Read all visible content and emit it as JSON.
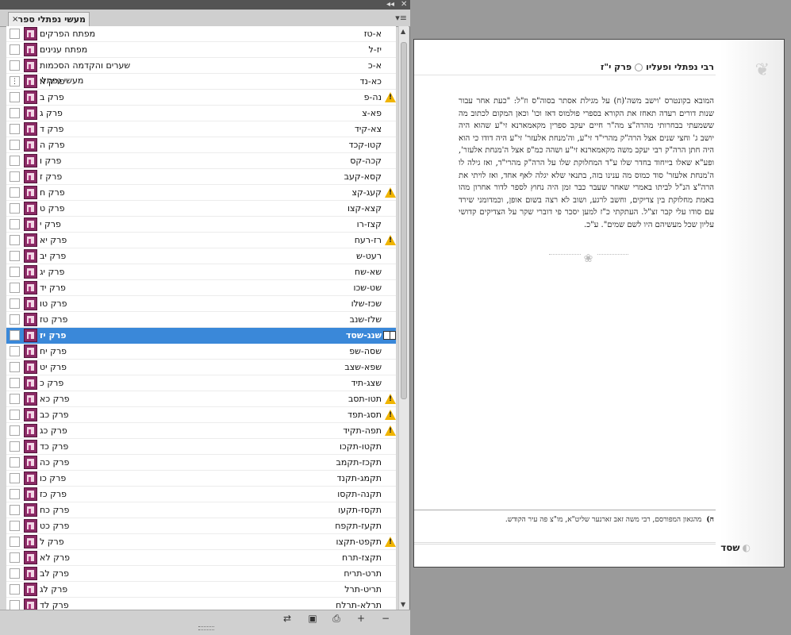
{
  "panel": {
    "collapse_glyph": "◂◂",
    "close_glyph": "✕",
    "tab_title": "מעשי נפתלי ספר",
    "tab_close": "×",
    "menu_glyph": "▾≡",
    "rows": [
      {
        "name": "מפתח הפרקים",
        "pages": "א-טז",
        "status": "none"
      },
      {
        "name": "מפתח ענינים",
        "pages": "יז-ל",
        "status": "none"
      },
      {
        "name": "שערים והקדמה הסכמות מעשי נפתלי",
        "pages": "א-כ",
        "status": "none"
      },
      {
        "name": "פרק א",
        "pages": "כא-נד",
        "status": "none"
      },
      {
        "name": "פרק ב",
        "pages": "נה-פ",
        "status": "warning"
      },
      {
        "name": "פרק ג",
        "pages": "פא-צ",
        "status": "none"
      },
      {
        "name": "פרק ד",
        "pages": "צא-קיד",
        "status": "none"
      },
      {
        "name": "פרק ה",
        "pages": "קטו-קכד",
        "status": "none"
      },
      {
        "name": "פרק ו",
        "pages": "קכה-קס",
        "status": "none"
      },
      {
        "name": "פרק ז",
        "pages": "קסא-קעב",
        "status": "none"
      },
      {
        "name": "פרק ח",
        "pages": "קעג-קצ",
        "status": "warning"
      },
      {
        "name": "פרק ט",
        "pages": "קצא-קצו",
        "status": "none"
      },
      {
        "name": "פרק י",
        "pages": "קצז-רו",
        "status": "none"
      },
      {
        "name": "פרק יא",
        "pages": "רז-רעח",
        "status": "warning"
      },
      {
        "name": "פרק יב",
        "pages": "רעט-ש",
        "status": "none"
      },
      {
        "name": "פרק יג",
        "pages": "שא-שח",
        "status": "none"
      },
      {
        "name": "פרק יד",
        "pages": "שט-שכו",
        "status": "none"
      },
      {
        "name": "פרק טו",
        "pages": "שכז-שלו",
        "status": "none"
      },
      {
        "name": "פרק טז",
        "pages": "שלז-שנב",
        "status": "none"
      },
      {
        "name": "פרק יז",
        "pages": "שנג-שסד",
        "status": "open",
        "selected": true
      },
      {
        "name": "פרק יח",
        "pages": "שסה-שפ",
        "status": "none"
      },
      {
        "name": "פרק יט",
        "pages": "שפא-שצב",
        "status": "none"
      },
      {
        "name": "פרק כ",
        "pages": "שצג-תיד",
        "status": "none"
      },
      {
        "name": "פרק כא",
        "pages": "תטו-תסב",
        "status": "warning"
      },
      {
        "name": "פרק כב",
        "pages": "תסג-תפד",
        "status": "warning"
      },
      {
        "name": "פרק כג",
        "pages": "תפה-תקיד",
        "status": "warning"
      },
      {
        "name": "פרק כד",
        "pages": "תקטו-תקכו",
        "status": "none"
      },
      {
        "name": "פרק כה",
        "pages": "תקכז-תקמב",
        "status": "none"
      },
      {
        "name": "פרק כו",
        "pages": "תקמג-תקנד",
        "status": "none"
      },
      {
        "name": "פרק כז",
        "pages": "תקנה-תקסו",
        "status": "none"
      },
      {
        "name": "פרק כח",
        "pages": "תקסז-תקעו",
        "status": "none"
      },
      {
        "name": "פרק כט",
        "pages": "תקעז-תקפח",
        "status": "none"
      },
      {
        "name": "פרק ל",
        "pages": "תקפט-תקצו",
        "status": "warning"
      },
      {
        "name": "פרק לא",
        "pages": "תקצז-תרח",
        "status": "none"
      },
      {
        "name": "פרק לב",
        "pages": "תרט-תריח",
        "status": "none"
      },
      {
        "name": "פרק לג",
        "pages": "תריט-תרל",
        "status": "none"
      },
      {
        "name": "פרק לד",
        "pages": "תרלא-תרלח",
        "status": "none"
      }
    ],
    "row4_marker": "⋮",
    "bottom_icons": [
      "synchronize-icon",
      "save-icon",
      "print-icon",
      "add-document-icon",
      "remove-document-icon"
    ]
  },
  "page": {
    "header": "פרק י\"ז",
    "header_title": "רבי נפתלי ופעליו",
    "paragraph": "המובא בקונטרס 'וישב משה'(ח) על מגילת אסתר בסוה\"ס וז\"ל: \"כעת אחר עבור שנות דורים רעדה תאחז את הקורא בספרי פולמוס דאז וכו' וכאן המקום לכתוב מה ששמעתי בבחרותי מהרה\"צ מה\"ר חיים יעקב ספרין מקאמארנא זי\"ע שהוא היה יושב ג' וחצי שנים אצל הרה\"ק מהרי\"ד זי\"ע, וה'מנחת אלעזר' זי\"ע היה דודו כי הוא היה חתן הרה\"ק רבי יעקב משה מקאמארנא זי\"ע ושהה כמ\"פ אצל ה'מנחת אלעזר', ופע\"א שאלו בייחוד בחדר שלו ע\"ד המחלוקת שלו על הרה\"ק מהרי\"ד, ואז גילה לו ה'מנחת אלעזר' סוד כמוס מה ענינו בזה, בתנאי שלא יגלה לאף אחד, ואז לויתי את הרה\"צ הנ\"ל לביתו באמרי שאחר שעבר כבר זמן היה נחוץ לספר לדור אחרון מהו באמת מחלוקת בין צדיקים, וחשב לרגע, ושוב לא רצה בשום אופן, וכמדומני שירד עם סודו עלי קבר זצ\"ל. העתקתי כ\"ז למען יסכר פי דוברי שקר על הצדיקים קדושי עליון שכל מעשיהם היו לשם שמים\". ע\"כ.",
    "divider_glyph": "❀",
    "ornament_glyph": "❦",
    "footnote_num": "ח)",
    "footnote": "מהגאון המפורסם, רבי משה זאב זארנער שליט\"א, מו\"צ פה עיר הקודש.",
    "page_number": "שסד"
  }
}
